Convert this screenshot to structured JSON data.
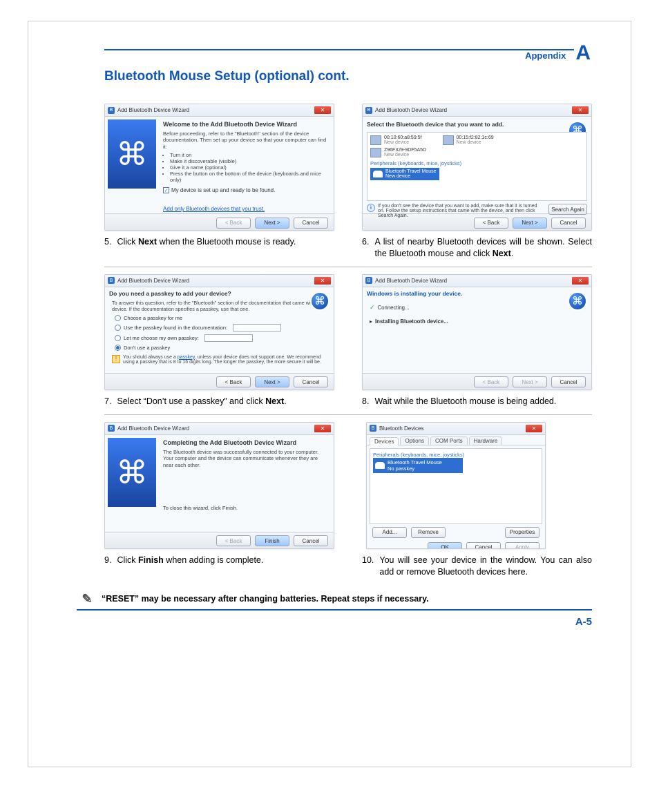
{
  "header": {
    "appendix": "Appendix",
    "letter": "A"
  },
  "title": "Bluetooth Mouse Setup (optional) cont.",
  "bt_glyph": "฿",
  "shots": {
    "s5": {
      "win_title": "Add Bluetooth Device Wizard",
      "heading": "Welcome to the Add Bluetooth Device Wizard",
      "para": "Before proceeding, refer to the \"Bluetooth\" section of the device documentation. Then set up your device so that your computer can find it:",
      "bullets": [
        "Turn it on",
        "Make it discoverable (visible)",
        "Give it a name (optional)",
        "Press the button on the bottom of the device (keyboards and mice only)"
      ],
      "check": "My device is set up and ready to be found.",
      "link": "Add only Bluetooth devices that you trust.",
      "btn_back": "< Back",
      "btn_next": "Next >",
      "btn_cancel": "Cancel"
    },
    "s6": {
      "win_title": "Add Bluetooth Device Wizard",
      "prompt": "Select the Bluetooth device that you want to add.",
      "dev1_mac": "00:10:60:a8:59:5f",
      "dev1_sub": "New device",
      "dev2_mac": "00:15:f2:82:1c:69",
      "dev2_sub": "New device",
      "dev3_name": "Z96F329-9DF5A5D",
      "dev3_sub": "New device",
      "periph_label": "Peripherals (keyboards, mice, joysticks)",
      "sel_name": "Bluetooth Travel Mouse",
      "sel_sub": "New device",
      "info": "If you don't see the device that you want to add, make sure that it is turned on. Follow the setup instructions that came with the device, and then click Search Again.",
      "btn_search": "Search Again",
      "btn_back": "< Back",
      "btn_next": "Next >",
      "btn_cancel": "Cancel"
    },
    "s7": {
      "win_title": "Add Bluetooth Device Wizard",
      "prompt": "Do you need a passkey to add your device?",
      "sub": "To answer this question, refer to the \"Bluetooth\" section of the documentation that came with your device. If the documentation specifies a passkey, use that one.",
      "r1": "Choose a passkey for me",
      "r2": "Use the passkey found in the documentation:",
      "r3": "Let me choose my own passkey:",
      "r4": "Don't use a passkey",
      "warn_pre": "You should always use a ",
      "warn_link": "passkey",
      "warn_post": ", unless your device does not support one. We recommend using a passkey that is 8 to 16 digits long. The longer the passkey, the more secure it will be.",
      "btn_back": "< Back",
      "btn_next": "Next >",
      "btn_cancel": "Cancel"
    },
    "s8": {
      "win_title": "Add Bluetooth Device Wizard",
      "prompt": "Windows is installing your device.",
      "l1": "Connecting...",
      "l2": "Installing Bluetooth device...",
      "btn_back": "< Back",
      "btn_next": "Next >",
      "btn_cancel": "Cancel"
    },
    "s9": {
      "win_title": "Add Bluetooth Device Wizard",
      "heading": "Completing the Add Bluetooth Device Wizard",
      "para": "The Bluetooth device was successfully connected to your computer. Your computer and the device can communicate whenever they are near each other.",
      "closeline": "To close this wizard, click Finish.",
      "btn_back": "< Back",
      "btn_finish": "Finish",
      "btn_cancel": "Cancel"
    },
    "s10": {
      "win_title": "Bluetooth Devices",
      "tabs": [
        "Devices",
        "Options",
        "COM Ports",
        "Hardware"
      ],
      "group": "Peripherals (keyboards, mice, joysticks)",
      "dev": "Bluetooth Travel Mouse",
      "dev_sub": "No passkey",
      "btn_add": "Add...",
      "btn_remove": "Remove",
      "btn_props": "Properties",
      "btn_ok": "OK",
      "btn_cancel": "Cancel",
      "btn_apply": "Apply"
    }
  },
  "captions": {
    "c5": {
      "num": "5.",
      "pre": "Click ",
      "bold": "Next",
      "post": " when the Bluetooth mouse is ready."
    },
    "c6": {
      "num": "6.",
      "pre": "A list of nearby Bluetooth devices will be shown. Select the Bluetooth mouse and click ",
      "bold": "Next",
      "post": "."
    },
    "c7": {
      "num": "7.",
      "pre": "Select “Don’t use a passkey” and click ",
      "bold": "Next",
      "post": "."
    },
    "c8": {
      "num": "8.",
      "text": "Wait while the Bluetooth mouse is being added."
    },
    "c9": {
      "num": "9.",
      "pre": "Click ",
      "bold": "Finish",
      "post": " when adding is complete."
    },
    "c10": {
      "num": "10.",
      "text": "You will see your device in the window. You can also add or remove Bluetooth devices here."
    }
  },
  "note": "“RESET” may be necessary after changing batteries. Repeat steps if necessary.",
  "pagenum": "A-5"
}
